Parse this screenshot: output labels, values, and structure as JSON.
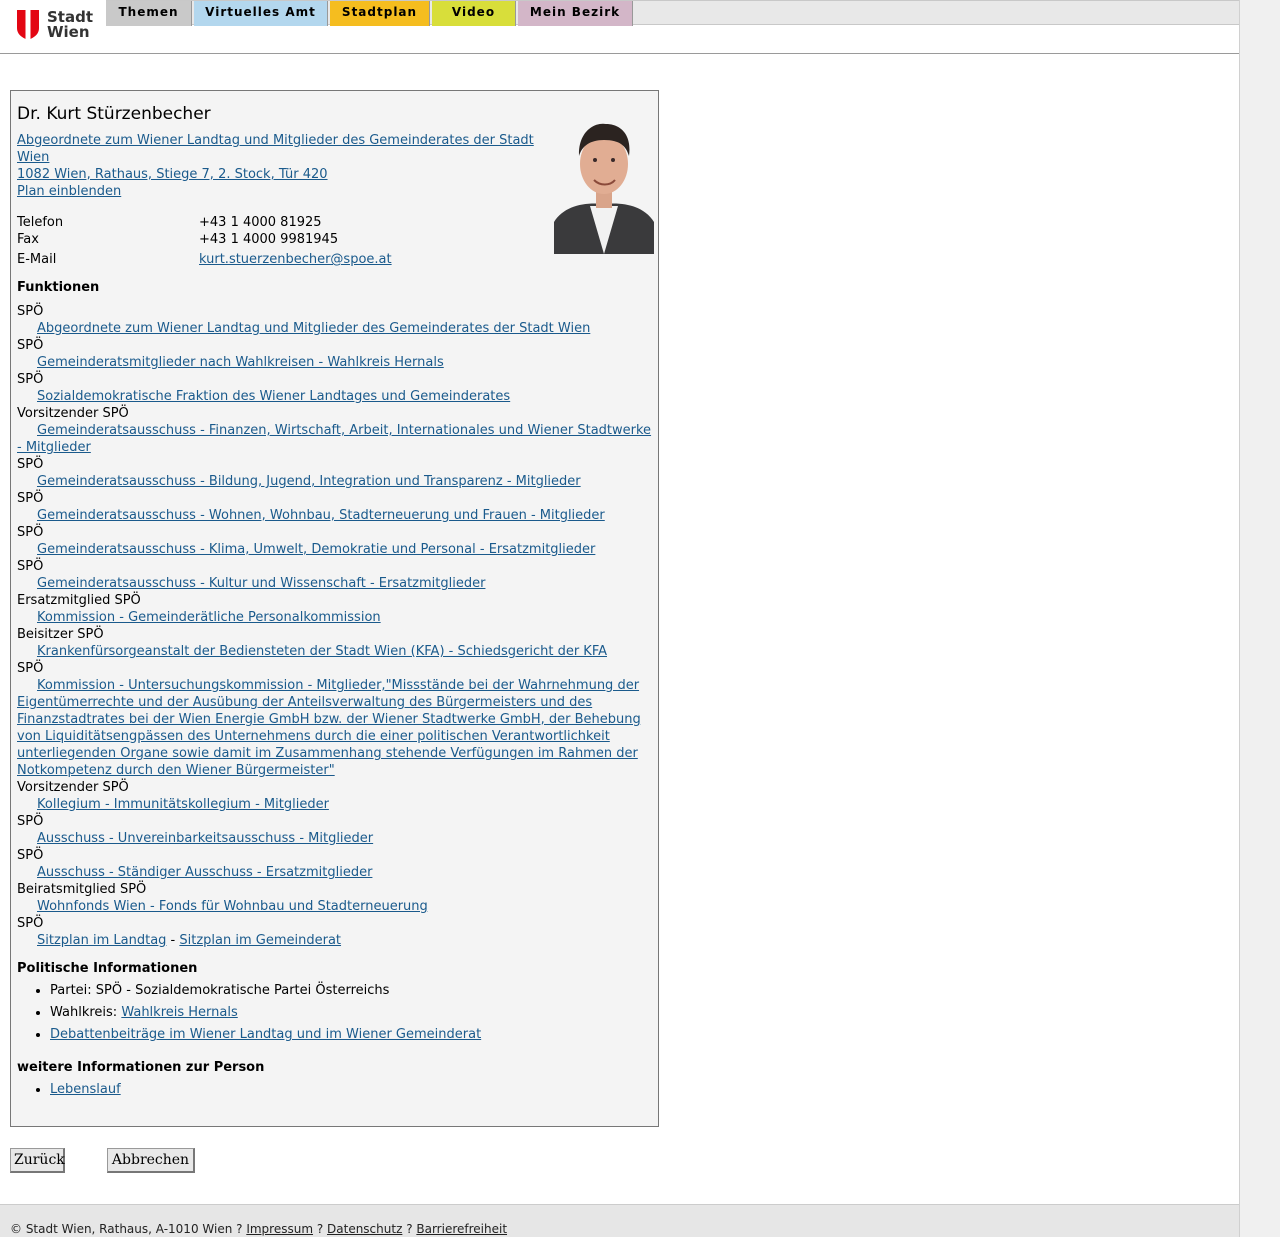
{
  "logo": {
    "line1": "Stadt",
    "line2": "Wien"
  },
  "nav": [
    {
      "label": "Themen",
      "color": "#c9c9c9"
    },
    {
      "label": "Virtuelles Amt",
      "color": "#b3d7ee"
    },
    {
      "label": "Stadtplan",
      "color": "#f5bd1f"
    },
    {
      "label": "Video",
      "color": "#d8de3a"
    },
    {
      "label": "Mein Bezirk",
      "color": "#d3b6c8"
    }
  ],
  "person": {
    "name": "Dr. Kurt Stürzenbecher",
    "affiliation": "Abgeordnete zum Wiener Landtag und Mitglieder des Gemeinderates der Stadt Wien ",
    "address": "1082 Wien, Rathaus, Stiege 7, 2. Stock, Tür 420",
    "plan_link": "Plan einblenden",
    "contact": [
      {
        "label": "Telefon",
        "value": "+43 1 4000 81925"
      },
      {
        "label": "Fax",
        "value": "+43 1 4000 9981945"
      },
      {
        "label": "E-Mail",
        "value": "kurt.stuerzenbecher@spoe.at"
      }
    ]
  },
  "functions_title": "Funktionen",
  "functions": [
    {
      "role": "SPÖ",
      "org": "Abgeordnete zum Wiener Landtag und Mitglieder des Gemeinderates der Stadt Wien"
    },
    {
      "role": "SPÖ",
      "org": "Gemeinderatsmitglieder nach Wahlkreisen - Wahlkreis Hernals"
    },
    {
      "role": "SPÖ",
      "org": "Sozialdemokratische Fraktion des Wiener Landtages und Gemeinderates"
    },
    {
      "role": "Vorsitzender SPÖ",
      "org": "Gemeinderatsausschuss - Finanzen, Wirtschaft, Arbeit, Internationales und Wiener Stadtwerke - Mitglieder"
    },
    {
      "role": "SPÖ",
      "org": "Gemeinderatsausschuss - Bildung, Jugend, Integration und Transparenz - Mitglieder"
    },
    {
      "role": "SPÖ",
      "org": "Gemeinderatsausschuss - Wohnen, Wohnbau, Stadterneuerung und Frauen - Mitglieder"
    },
    {
      "role": "SPÖ",
      "org": "Gemeinderatsausschuss - Klima, Umwelt, Demokratie und Personal - Ersatzmitglieder"
    },
    {
      "role": "SPÖ",
      "org": "Gemeinderatsausschuss - Kultur und Wissenschaft - Ersatzmitglieder"
    },
    {
      "role": "Ersatzmitglied SPÖ",
      "org": "Kommission - Gemeinderätliche Personalkommission"
    },
    {
      "role": "Beisitzer SPÖ",
      "org": "Krankenfürsorgeanstalt der Bediensteten der Stadt Wien (KFA) - Schiedsgericht der KFA"
    },
    {
      "role": "SPÖ",
      "org": "Kommission - Untersuchungskommission - Mitglieder,\"Missstände bei der Wahrnehmung der Eigentümerrechte und der Ausübung der Anteilsverwaltung des Bürgermeisters und des Finanzstadtrates bei der Wien Energie GmbH bzw. der Wiener Stadtwerke GmbH, der Behebung von Liquiditätsengpässen des Unternehmens durch die einer politischen Verantwortlichkeit unterliegenden Organe sowie damit im Zusammenhang stehende Verfügungen im Rahmen der Notkompetenz durch den Wiener Bürgermeister\""
    },
    {
      "role": "Vorsitzender SPÖ",
      "org": "Kollegium - Immunitätskollegium - Mitglieder"
    },
    {
      "role": "SPÖ",
      "org": "Ausschuss - Unvereinbarkeitsausschuss - Mitglieder"
    },
    {
      "role": "SPÖ",
      "org": "Ausschuss - Ständiger Ausschuss - Ersatzmitglieder"
    },
    {
      "role": "Beiratsmitglied SPÖ",
      "org": "Wohnfonds Wien - Fonds für Wohnbau und Stadterneuerung"
    },
    {
      "role": "SPÖ",
      "org": ""
    }
  ],
  "seating": {
    "landtag": "Sitzplan im Landtag",
    "separator": " - ",
    "gemeinderat": "Sitzplan im Gemeinderat"
  },
  "political_title": "Politische Informationen",
  "political": {
    "party_label": "Partei: SPÖ - Sozialdemokratische Partei Österreichs",
    "constituency_label": "Wahlkreis: ",
    "constituency_link": "Wahlkreis Hernals",
    "debates_link": "Debattenbeiträge im Wiener Landtag und im Wiener Gemeinderat"
  },
  "more_title": "weitere Informationen zur Person",
  "more": {
    "cv_link": "Lebenslauf"
  },
  "buttons": {
    "back": "Zurück",
    "cancel": "Abbrechen"
  },
  "footer": {
    "copyright": "© Stadt Wien, Rathaus, A-1010 Wien ? ",
    "impressum": "Impressum",
    "sep1": " ? ",
    "datenschutz": "Datenschutz",
    "sep2": " ? ",
    "barrierefreiheit": "Barrierefreiheit"
  }
}
